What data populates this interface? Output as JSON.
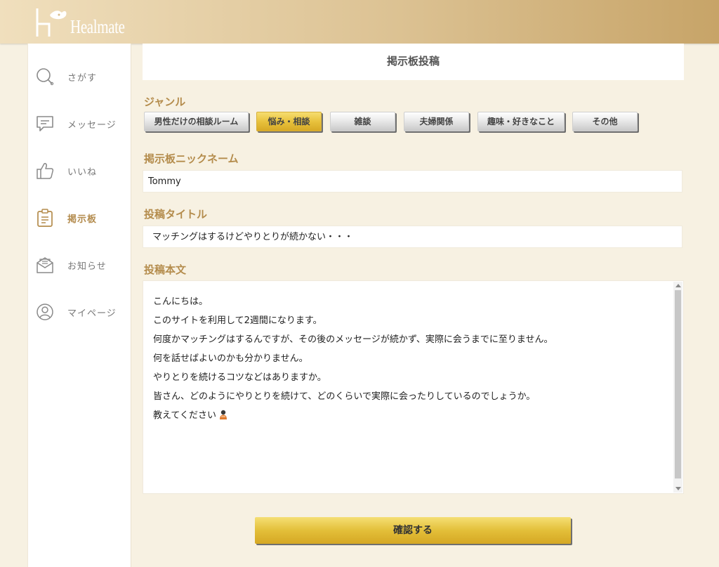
{
  "header": {
    "logo_text": "Healmate"
  },
  "sidebar": {
    "items": [
      {
        "label": "さがす",
        "icon": "search-icon",
        "active": false
      },
      {
        "label": "メッセージ",
        "icon": "message-icon",
        "active": false
      },
      {
        "label": "いいね",
        "icon": "thumbs-up-icon",
        "active": false
      },
      {
        "label": "掲示板",
        "icon": "clipboard-icon",
        "active": true
      },
      {
        "label": "お知らせ",
        "icon": "mail-icon",
        "active": false
      },
      {
        "label": "マイページ",
        "icon": "user-icon",
        "active": false
      }
    ]
  },
  "page": {
    "title": "掲示板投稿"
  },
  "genre": {
    "label": "ジャンル",
    "options": [
      "男性だけの相談ルーム",
      "悩み・相談",
      "雑談",
      "夫婦関係",
      "趣味・好きなこと",
      "その他"
    ],
    "selected": "悩み・相談"
  },
  "nickname": {
    "label": "掲示板ニックネーム",
    "value": "Tommy"
  },
  "post_title": {
    "label": "投稿タイトル",
    "value": "マッチングはするけどやりとりが続かない・・・"
  },
  "body": {
    "label": "投稿本文",
    "lines": [
      "こんにちは。",
      "このサイトを利用して2週間になります。",
      "何度かマッチングはするんですが、その後のメッセージが続かず、実際に会うまでに至りません。",
      "何を話せばよいのかも分かりません。",
      "やりとりを続けるコツなどはありますか。",
      "皆さん、どのようにやりとりを続けて、どのくらいで実際に会ったりしているのでしょうか。",
      "教えてください"
    ],
    "trailing_emoji": "person-bowing-emoji"
  },
  "confirm_button": {
    "label": "確認する"
  },
  "colors": {
    "accent_gold": "#e3bf39",
    "label_brown": "#b48c4c",
    "background": "#f7f1e2"
  }
}
